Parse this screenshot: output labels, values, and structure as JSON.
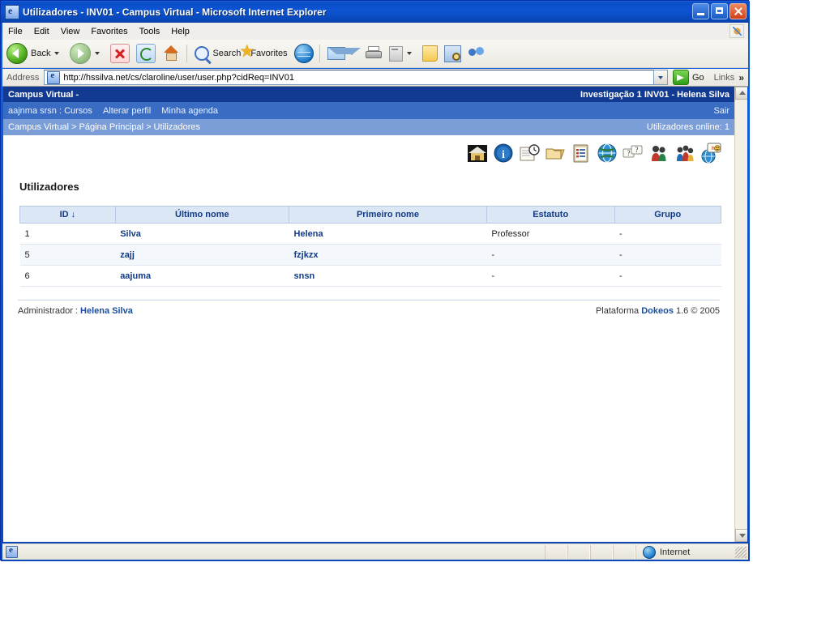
{
  "window": {
    "title": "Utilizadores - INV01 - Campus Virtual - Microsoft Internet Explorer",
    "minimize": "Minimize",
    "maximize": "Maximize",
    "close": "Close"
  },
  "menubar": {
    "items": [
      {
        "label": "File"
      },
      {
        "label": "Edit"
      },
      {
        "label": "View"
      },
      {
        "label": "Favorites"
      },
      {
        "label": "Tools"
      },
      {
        "label": "Help"
      }
    ]
  },
  "toolbar": {
    "back": "Back",
    "forward": "",
    "stop": "",
    "refresh": "",
    "home": "",
    "search": "Search",
    "favorites": "Favorites",
    "history": "",
    "mail": "",
    "print": "",
    "edit": "",
    "discuss": "",
    "research": "",
    "messenger": ""
  },
  "address": {
    "label": "Address",
    "url": "http://hssilva.net/cs/claroline/user/user.php?cidReq=INV01",
    "go": "Go",
    "links": "Links",
    "chevron": "»"
  },
  "dokeos": {
    "banner_left": "Campus Virtual -",
    "banner_right": "Investigação 1 INV01 - Helena Silva",
    "nav": [
      {
        "label": "aajnma srsn : Cursos"
      },
      {
        "label": "Alterar perfil"
      },
      {
        "label": "Minha agenda"
      }
    ],
    "logout": "Sair",
    "breadcrumb": "Campus Virtual > Página Principal > Utilizadores",
    "online": "Utilizadores online: 1",
    "tool_icons": [
      {
        "name": "home-icon",
        "title": "Home"
      },
      {
        "name": "info-icon",
        "title": "Descrição"
      },
      {
        "name": "agenda-icon",
        "title": "Agenda"
      },
      {
        "name": "documents-icon",
        "title": "Documentos"
      },
      {
        "name": "assignments-icon",
        "title": "Trabalhos"
      },
      {
        "name": "links-icon",
        "title": "Ligações"
      },
      {
        "name": "faq-icon",
        "title": "FAQ"
      },
      {
        "name": "users-icon",
        "title": "Utilizadores"
      },
      {
        "name": "groups-icon",
        "title": "Grupos"
      },
      {
        "name": "chat-icon",
        "title": "Chat"
      }
    ],
    "page_title": "Utilizadores",
    "table": {
      "columns": [
        {
          "label": "ID",
          "sort": "↓"
        },
        {
          "label": "Último nome",
          "sort": ""
        },
        {
          "label": "Primeiro nome",
          "sort": ""
        },
        {
          "label": "Estatuto",
          "sort": ""
        },
        {
          "label": "Grupo",
          "sort": ""
        }
      ],
      "rows": [
        {
          "id": "1",
          "last": "Silva",
          "first": "Helena",
          "status": "Professor",
          "group": "-"
        },
        {
          "id": "5",
          "last": "zajj",
          "first": "fzjkzx",
          "status": "-",
          "group": "-"
        },
        {
          "id": "6",
          "last": "aajuma",
          "first": "snsn",
          "status": "-",
          "group": "-"
        }
      ]
    },
    "footer_admin_label": "Administrador : ",
    "footer_admin_name": "Helena Silva",
    "footer_platform_label": "Plataforma ",
    "footer_platform_name": "Dokeos",
    "footer_platform_version": " 1.6 © 2005"
  },
  "statusbar": {
    "zone": "Internet"
  }
}
